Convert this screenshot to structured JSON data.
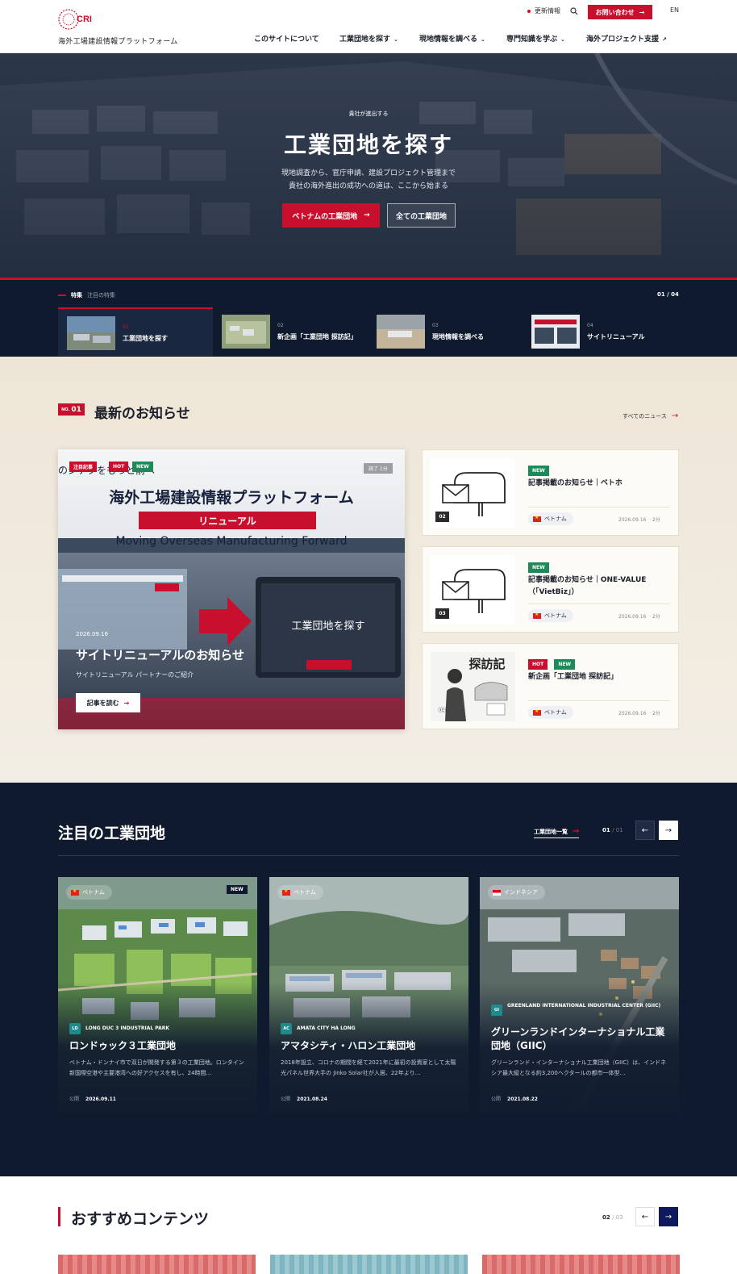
{
  "header": {
    "logo_text": "海外工場建設情報プラットフォーム",
    "updates": "更新情報",
    "contact": "お問い合わせ",
    "lang": "EN",
    "nav": [
      {
        "label": "このサイトについて",
        "icon": ""
      },
      {
        "label": "工業団地を探す",
        "icon": "chevron-down-icon"
      },
      {
        "label": "現地情報を調べる",
        "icon": "chevron-down-icon"
      },
      {
        "label": "専門知識を学ぶ",
        "icon": "chevron-down-icon"
      },
      {
        "label": "海外プロジェクト支援",
        "icon": "external-link-icon"
      }
    ]
  },
  "hero": {
    "eyebrow": "貴社が進出する",
    "title": "工業団地を探す",
    "sub1": "現地調査から、官庁申請、建設プロジェクト管理まで",
    "sub2": "貴社の海外進出の成功への道は、ここから始まる",
    "btn_primary": "ベトナムの工業団地",
    "btn_secondary": "全ての工業団地"
  },
  "features": {
    "label": "特集",
    "sub": "注目の特集",
    "count": "01 / 04",
    "items": [
      {
        "num": "01",
        "title": "工業団地を探す"
      },
      {
        "num": "02",
        "title": "新企画「工業団地 探訪記」"
      },
      {
        "num": "03",
        "title": "現地情報を調べる"
      },
      {
        "num": "04",
        "title": "サイトリニューアル"
      }
    ]
  },
  "news": {
    "tag_no": "NO.",
    "tag_num": "01",
    "title": "最新のお知らせ",
    "all_label": "すべてのニュース",
    "featured": {
      "badges": [
        "注目記事",
        "HOT",
        "NEW"
      ],
      "time": "読了 1分",
      "overlay_partial": "のシテクをもっと前へ",
      "head": "海外工場建設情報プラットフォーム",
      "banner": "リニューアル",
      "eng": "Moving Overseas Manufacturing Forward",
      "date": "2026.09.16",
      "title": "サイトリニューアルのお知らせ",
      "sub": "サイトリニューアル パートナーのご紹介",
      "read_more": "記事を読む"
    },
    "items": [
      {
        "num": "02",
        "badges": [
          "NEW"
        ],
        "title": "記事掲載のお知らせ｜ベトホ",
        "country": "ベトナム",
        "date": "2026.09.16",
        "read": "2分"
      },
      {
        "num": "03",
        "badges": [
          "NEW"
        ],
        "title": "記事掲載のお知らせ｜ONE-VALUE（「VietBiz」）",
        "country": "ベトナム",
        "date": "2026.09.16",
        "read": "2分"
      },
      {
        "num": "04",
        "badges": [
          "HOT",
          "NEW"
        ],
        "title": "新企画「工業団地 探訪記」",
        "country": "ベトナム",
        "date": "2026.09.16",
        "read": "2分",
        "thumb_text": "探訪記"
      }
    ]
  },
  "parks": {
    "title": "注目の工業団地",
    "all_label": "工業団地一覧",
    "count_current": "01",
    "count_total": "/ 01",
    "items": [
      {
        "country": "ベトナム",
        "flag": "vn",
        "new": "NEW",
        "code": "LD",
        "code_color": "#1e8a8a",
        "en": "LONG DUC 3 INDUSTRIAL PARK",
        "name": "ロンドゥック３工業団地",
        "desc": "ベトナム・ドンナイ市で双日が開発する第３の工業団地。ロンタイン新国際空港や主要港湾への好アクセスを有し、24時間…",
        "date_label": "公開",
        "date": "2026.09.11"
      },
      {
        "country": "ベトナム",
        "flag": "vn",
        "new": "",
        "code": "AC",
        "code_color": "#1e8a8a",
        "en": "AMATA CITY HA LONG",
        "name": "アマタシティ・ハロン工業団地",
        "desc": "2018年設立、コロナの期間を経て2021年に最初の投資家として太陽光パネル世界大手の Jinko Solar社が入居、22年より…",
        "date_label": "公開",
        "date": "2021.08.24"
      },
      {
        "country": "インドネシア",
        "flag": "id",
        "new": "",
        "code": "GI",
        "code_color": "#1e8a8a",
        "en": "GREENLAND INTERNATIONAL INDUSTRIAL CENTER (GIIC)",
        "name": "グリーンランドインターナショナル工業団地（GIIC）",
        "desc": "グリーンランド・インターナショナル工業団地（GIIC）は、インドネシア最大級となる約3,200ヘクタールの都市一体型…",
        "date_label": "公開",
        "date": "2021.08.22"
      }
    ]
  },
  "recommend": {
    "title": "おすすめコンテンツ",
    "count_current": "02",
    "count_total": "/ 03"
  },
  "colors": {
    "accent": "#c8102e",
    "navy": "#0f1a2e",
    "cream": "#f1ebe0",
    "green": "#1e8a5a"
  }
}
